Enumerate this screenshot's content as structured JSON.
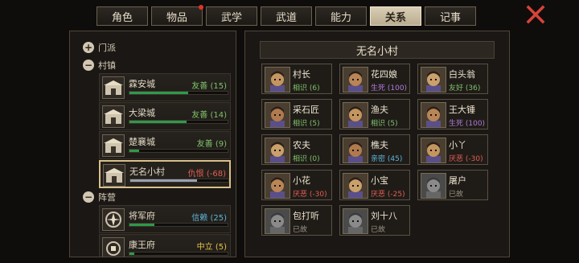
{
  "tabs": [
    {
      "label": "角色",
      "active": false,
      "dot": false
    },
    {
      "label": "物品",
      "active": false,
      "dot": true
    },
    {
      "label": "武学",
      "active": false,
      "dot": false
    },
    {
      "label": "武道",
      "active": false,
      "dot": false
    },
    {
      "label": "能力",
      "active": false,
      "dot": false
    },
    {
      "label": "关系",
      "active": true,
      "dot": false
    },
    {
      "label": "记事",
      "active": false,
      "dot": false
    }
  ],
  "left": {
    "groups": [
      {
        "label": "门派",
        "expanded": false
      },
      {
        "label": "村镇",
        "expanded": true
      },
      {
        "label": "阵营",
        "expanded": true
      }
    ],
    "factions": [
      {
        "name": "霖安城",
        "relation": "友善 (15)",
        "tone": "green",
        "level": 0.6
      },
      {
        "name": "大梁城",
        "relation": "友善 (14)",
        "tone": "green",
        "level": 0.58
      },
      {
        "name": "楚襄城",
        "relation": "友善 (9)",
        "tone": "green",
        "level": 0.1
      },
      {
        "name": "无名小村",
        "relation": "仇恨 (-68)",
        "tone": "red",
        "level": 0.68
      },
      {
        "name": "将军府",
        "relation": "信赖 (25)",
        "tone": "blue",
        "level": 0.25
      },
      {
        "name": "康王府",
        "relation": "中立 (5)",
        "tone": "yellow",
        "level": 0.05
      }
    ]
  },
  "right": {
    "title": "无名小村",
    "npcs": [
      {
        "name": "村长",
        "status": "相识 (6)",
        "tone": "green"
      },
      {
        "name": "花四娘",
        "status": "生死 (100)",
        "tone": "purple"
      },
      {
        "name": "白头翁",
        "status": "友好 (36)",
        "tone": "green"
      },
      {
        "name": "采石匠",
        "status": "相识 (5)",
        "tone": "green"
      },
      {
        "name": "渔夫",
        "status": "相识 (5)",
        "tone": "green"
      },
      {
        "name": "王大锤",
        "status": "生死 (100)",
        "tone": "purple"
      },
      {
        "name": "农夫",
        "status": "相识 (0)",
        "tone": "green"
      },
      {
        "name": "樵夫",
        "status": "亲密 (45)",
        "tone": "blue"
      },
      {
        "name": "小丫",
        "status": "厌恶 (-30)",
        "tone": "red"
      },
      {
        "name": "小花",
        "status": "厌恶 (-30)",
        "tone": "red"
      },
      {
        "name": "小宝",
        "status": "厌恶 (-25)",
        "tone": "red"
      },
      {
        "name": "屠户",
        "status": "已故",
        "tone": "grey"
      },
      {
        "name": "包打听",
        "status": "已故",
        "tone": "grey"
      },
      {
        "name": "刘十八",
        "status": "已故",
        "tone": "grey"
      }
    ]
  },
  "colors": {
    "green": "#7fc06a",
    "purple": "#b27ad8",
    "red": "#e35d52",
    "blue": "#5fb4d8",
    "yellow": "#e8c24a",
    "grey": "#9a9282"
  },
  "icons": {
    "close": "close-x-icon",
    "expand": "plus-icon",
    "collapse": "minus-icon",
    "faction": "city-gate-icon"
  }
}
